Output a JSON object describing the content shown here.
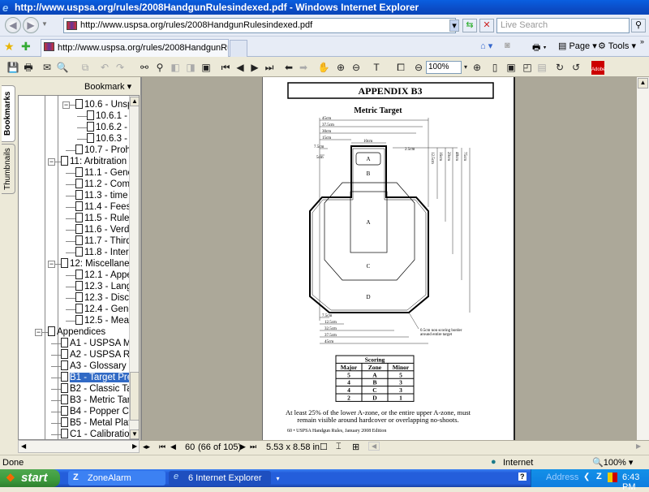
{
  "window": {
    "title": "http://www.uspsa.org/rules/2008HandgunRulesindexed.pdf - Windows Internet Explorer"
  },
  "browser": {
    "address": "http://www.uspsa.org/rules/2008HandgunRulesindexed.pdf",
    "search_placeholder": "Live Search",
    "tab_label": "http://www.uspsa.org/rules/2008HandgunRulesindex...",
    "page_label": "Page",
    "tools_label": "Tools",
    "more": "»"
  },
  "acrobat": {
    "zoom": "100%",
    "adobe": "Adobe"
  },
  "sidebar": {
    "bookmarks_tab": "Bookmarks",
    "thumbnails_tab": "Thumbnails",
    "header": "Bookmark ▾",
    "items": [
      {
        "label": "10.6 - Unspe",
        "level": 2,
        "expanded": true
      },
      {
        "label": "10.6.1 - U",
        "level": 3
      },
      {
        "label": "10.6.2 - U",
        "level": 3
      },
      {
        "label": "10.6.3 - I",
        "level": 3
      },
      {
        "label": "10.7 - Prohib",
        "level": 2
      },
      {
        "label": "11: Arbitration &",
        "level": 1,
        "expanded": true
      },
      {
        "label": "11.1 - Gener",
        "level": 2
      },
      {
        "label": "11.2 - Comp",
        "level": 2
      },
      {
        "label": "11.3 - time L",
        "level": 2
      },
      {
        "label": "11.4 - Fees",
        "level": 2
      },
      {
        "label": "11.5 - Rules",
        "level": 2
      },
      {
        "label": "11.6 - Verdic",
        "level": 2
      },
      {
        "label": "11.7 - Third",
        "level": 2
      },
      {
        "label": "11.8 - Interp",
        "level": 2
      },
      {
        "label": "12: Miscellaneo",
        "level": 1,
        "expanded": true
      },
      {
        "label": "12.1 - Apper",
        "level": 2
      },
      {
        "label": "12.3 - Langu",
        "level": 2
      },
      {
        "label": "12.3 - Discla",
        "level": 2
      },
      {
        "label": "12.4 - Gende",
        "level": 2
      },
      {
        "label": "12.5 - Meas",
        "level": 2
      },
      {
        "label": "Appendices",
        "level": 0,
        "expanded": true
      },
      {
        "label": "A1 - USPSA Ma",
        "level": 1
      },
      {
        "label": "A2 - USPSA Re",
        "level": 1
      },
      {
        "label": "A3 - Glossary",
        "level": 1
      },
      {
        "label": "B1 - Target Pres",
        "level": 1,
        "selected": true
      },
      {
        "label": "B2 - Classic Ta",
        "level": 1
      },
      {
        "label": "B3 - Metric Targ",
        "level": 1
      },
      {
        "label": "B4 - Popper Ca",
        "level": 1
      },
      {
        "label": "B5 - Metal Plate",
        "level": 1
      },
      {
        "label": "C1 - Calibration",
        "level": 1
      }
    ]
  },
  "document": {
    "heading": "APPENDIX B3",
    "subtitle": "Metric Target",
    "zones": {
      "a_upper": "A",
      "b": "B",
      "a_lower": "A",
      "c": "C",
      "d": "D"
    },
    "dims_top": [
      "45cm",
      "37.5cm",
      "30cm",
      "15cm",
      "10cm",
      "7.5cm",
      "5cm",
      "2.5cm"
    ],
    "dims_right": [
      "12.5cm",
      "16cm",
      "29cm",
      "48cm",
      "75cm"
    ],
    "dims_bottom": [
      "7.5cm",
      "12.5cm",
      "32.5cm",
      "37.5cm",
      "45cm"
    ],
    "border_note": [
      "0.5cm non scoring border",
      "around entire target"
    ],
    "scoring": {
      "title": "Scoring",
      "headers": [
        "Major",
        "Zone",
        "Minor"
      ],
      "rows": [
        [
          "5",
          "A",
          "5"
        ],
        [
          "4",
          "B",
          "3"
        ],
        [
          "4",
          "C",
          "3"
        ],
        [
          "2",
          "D",
          "1"
        ]
      ]
    },
    "note": [
      "At least 25% of the lower A-zone, or the entire upper A-zone, must",
      "remain visible around hardcover or overlapping no-shoots."
    ],
    "footer": "60 • USPSA Handgun Rules, January 2008 Edition"
  },
  "navbar": {
    "page": "60",
    "page_of": "(66 of 105)",
    "size": "5.53 x 8.58 in"
  },
  "status": {
    "text": "Done",
    "zone": "Internet",
    "zoom": "100%"
  },
  "taskbar": {
    "start": "start",
    "tasks": [
      "ZoneAlarm",
      "6 Internet Explorer"
    ],
    "address_label": "Address",
    "clock": "6:43 PM"
  }
}
